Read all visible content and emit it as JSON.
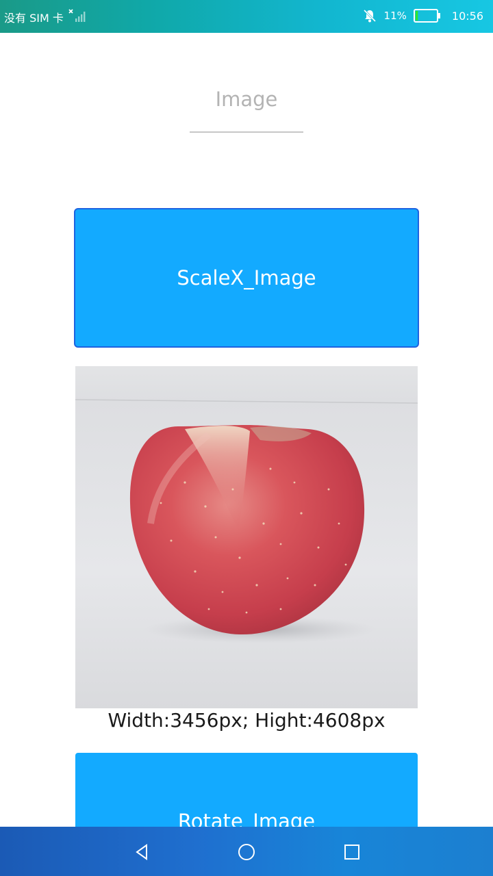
{
  "status_bar": {
    "carrier": "没有 SIM 卡",
    "battery_percent": "11%",
    "battery_level": 0.11,
    "time": "10:56",
    "icons": [
      "no-sim-signal-icon",
      "notifications-off-icon",
      "battery-icon"
    ]
  },
  "title_field": {
    "text": "Image"
  },
  "buttons": {
    "scale": "ScaleX_Image",
    "rotate": "Rotate_Image"
  },
  "image": {
    "subject": "apple-photo",
    "dimensions_text": "Width:3456px;    Hight:4608px"
  },
  "nav_bar": {
    "icons": [
      "back-icon",
      "home-icon",
      "recents-icon"
    ]
  },
  "colors": {
    "button_bg": "#13aaff",
    "button_focus_border": "#1d63e0",
    "apple_red": "#d1434f"
  }
}
